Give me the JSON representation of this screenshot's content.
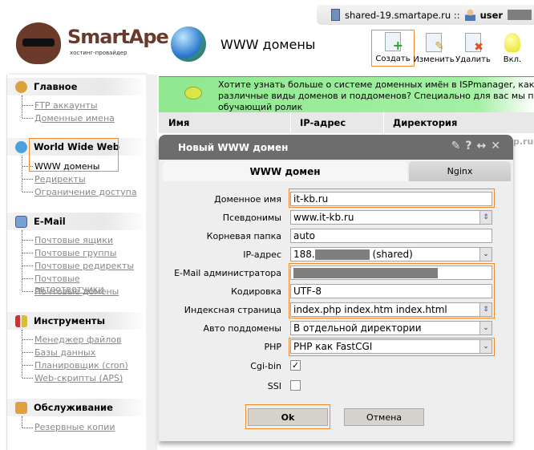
{
  "header": {
    "server": "shared-19.smartape.ru ::",
    "user": "user"
  },
  "logo": {
    "name": "SmartApe",
    "tagline": "хостинг-провайдер"
  },
  "page": {
    "title": "WWW домены"
  },
  "toolbar": [
    {
      "label": "Создать",
      "icon": "new-document-icon"
    },
    {
      "label": "Изменить",
      "icon": "edit-document-icon"
    },
    {
      "label": "Удалить",
      "icon": "delete-document-icon"
    },
    {
      "label": "Вкл.",
      "icon": "lightbulb-icon"
    }
  ],
  "sidebar": {
    "sections": [
      {
        "title": "Главное",
        "items": [
          "FTP аккаунты",
          "Доменные имена"
        ]
      },
      {
        "title": "World Wide Web",
        "items": [
          "WWW домены",
          "Редиректы",
          "Ограничение доступа"
        ]
      },
      {
        "title": "E-Mail",
        "items": [
          "Почтовые ящики",
          "Почтовые группы",
          "Почтовые редиректы",
          "Почтовые автоответчики",
          "Почтовые домены"
        ]
      },
      {
        "title": "Инструменты",
        "items": [
          "Менеджер файлов",
          "Базы данных",
          "Планировщик (cron)",
          "Web-скрипты (APS)"
        ]
      },
      {
        "title": "Обслуживание",
        "items": [
          "Резервные копии"
        ]
      }
    ]
  },
  "banner": {
    "lines": [
      "Хотите узнать больше о системе доменных имён в ISPmanager, как создавать",
      "различные виды доменов и поддоменов? Специально для вас мы подготовили",
      "обучающий ролик"
    ]
  },
  "table": {
    "columns": [
      "Имя",
      "IP-адрес",
      "Директория"
    ],
    "peek": "p.ru"
  },
  "dialog": {
    "title": "Новый WWW домен",
    "tabs": [
      "WWW домен",
      "Nginx"
    ],
    "fields": {
      "domain": {
        "label": "Доменное имя",
        "value": "it-kb.ru"
      },
      "aliases": {
        "label": "Псевдонимы",
        "value": "www.it-kb.ru"
      },
      "root": {
        "label": "Корневая папка",
        "value": "auto"
      },
      "ip": {
        "label": "IP-адрес",
        "value": "188.",
        "suffix": "(shared)"
      },
      "email": {
        "label": "E-Mail администратора",
        "value": ""
      },
      "charset": {
        "label": "Кодировка",
        "value": "UTF-8"
      },
      "index": {
        "label": "Индексная страница",
        "value": "index.php index.htm index.html"
      },
      "autosub": {
        "label": "Авто поддомены",
        "value": "В отдельной директории"
      },
      "php": {
        "label": "PHP",
        "value": "PHP как FastCGI"
      },
      "cgi": {
        "label": "Cgi-bin",
        "checked": true
      },
      "ssi": {
        "label": "SSI",
        "checked": false
      }
    },
    "ok": "Ok",
    "cancel": "Отмена"
  }
}
